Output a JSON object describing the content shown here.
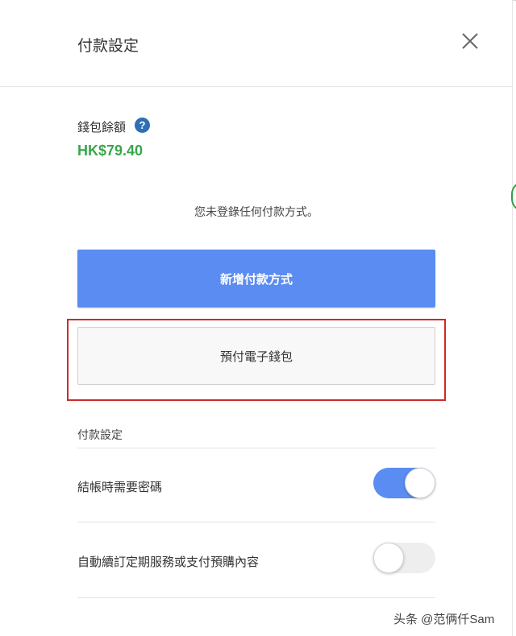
{
  "header": {
    "title": "付款設定"
  },
  "wallet": {
    "label": "錢包餘額",
    "help_glyph": "?",
    "balance": "HK$79.40"
  },
  "payment_methods": {
    "empty_text": "您未登錄任何付款方式。",
    "add_button_label": "新增付款方式",
    "prepaid_button_label": "預付電子錢包"
  },
  "settings": {
    "section_title": "付款設定",
    "items": [
      {
        "label": "結帳時需要密碼",
        "enabled": true
      },
      {
        "label": "自動續訂定期服務或支付預購內容",
        "enabled": false
      }
    ]
  },
  "watermark": "头条 @范俩仟Sam",
  "colors": {
    "accent": "#5b8cf2",
    "balance_green": "#3aa54a",
    "help_blue": "#2f6fb3",
    "highlight_red": "#cc2a2a"
  }
}
